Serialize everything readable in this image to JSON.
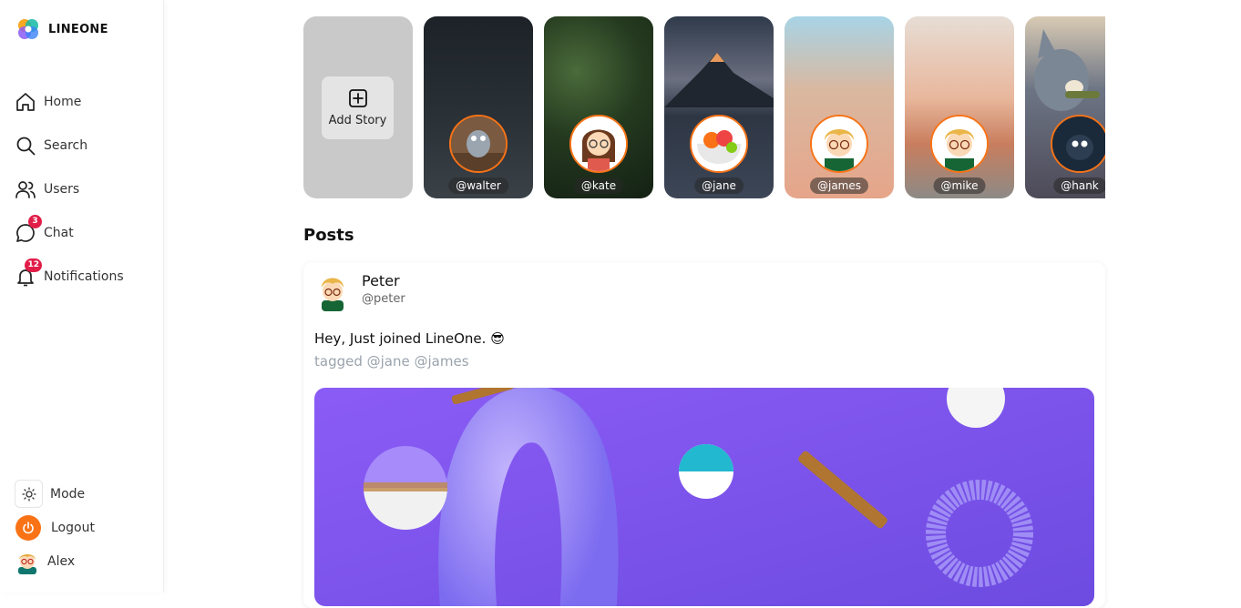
{
  "app": {
    "brand": "LINEONE"
  },
  "sidebar": {
    "items": [
      {
        "label": "Home",
        "icon": "home-icon"
      },
      {
        "label": "Search",
        "icon": "search-icon"
      },
      {
        "label": "Users",
        "icon": "users-icon"
      },
      {
        "label": "Chat",
        "icon": "chat-icon",
        "badge": "3"
      },
      {
        "label": "Notifications",
        "icon": "bell-icon",
        "badge": "12"
      }
    ],
    "bottom": {
      "mode_label": "Mode",
      "logout_label": "Logout",
      "user_label": "Alex"
    }
  },
  "stories": {
    "add_label": "Add Story",
    "items": [
      {
        "handle": "@walter"
      },
      {
        "handle": "@kate"
      },
      {
        "handle": "@jane"
      },
      {
        "handle": "@james"
      },
      {
        "handle": "@mike"
      },
      {
        "handle": "@hank"
      }
    ]
  },
  "posts": {
    "title": "Posts",
    "items": [
      {
        "author": "Peter",
        "handle": "@peter",
        "text": "Hey, Just joined LineOne. 😎",
        "tags": "tagged @jane @james"
      }
    ]
  },
  "colors": {
    "accent": "#f97316",
    "badge": "#e11d48",
    "post_image_bg": "#7c5ce8"
  }
}
